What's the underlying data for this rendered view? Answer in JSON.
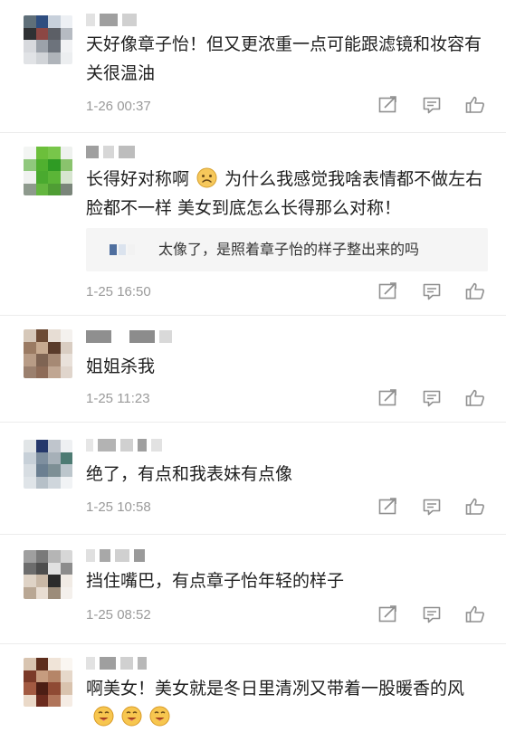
{
  "comments": [
    {
      "text": "天好像章子怡！但又更浓重一点可能跟滤镜和妆容有关很温油",
      "time": "1-26 00:37"
    },
    {
      "text_before_emoji": "长得好对称啊",
      "text_after_emoji": "为什么我感觉我啥表情都不做左右脸都不一样  美女到底怎么长得那么对称！",
      "quote": "太像了，是照着章子怡的样子整出来的吗",
      "time": "1-25 16:50"
    },
    {
      "text": "姐姐杀我",
      "time": "1-25 11:23"
    },
    {
      "text": "绝了，有点和我表妹有点像",
      "time": "1-25 10:58"
    },
    {
      "text": "挡住嘴巴，有点章子怡年轻的样子",
      "time": "1-25 08:52"
    },
    {
      "text": "啊美女！美女就是冬日里清冽又带着一股暖香的风",
      "time": ""
    }
  ],
  "icons": {
    "share": "share-icon",
    "reply": "reply-icon",
    "like": "thumbs-up-icon"
  },
  "colors": {
    "icon": "#8f8f8f",
    "time": "#9a9a9a"
  }
}
